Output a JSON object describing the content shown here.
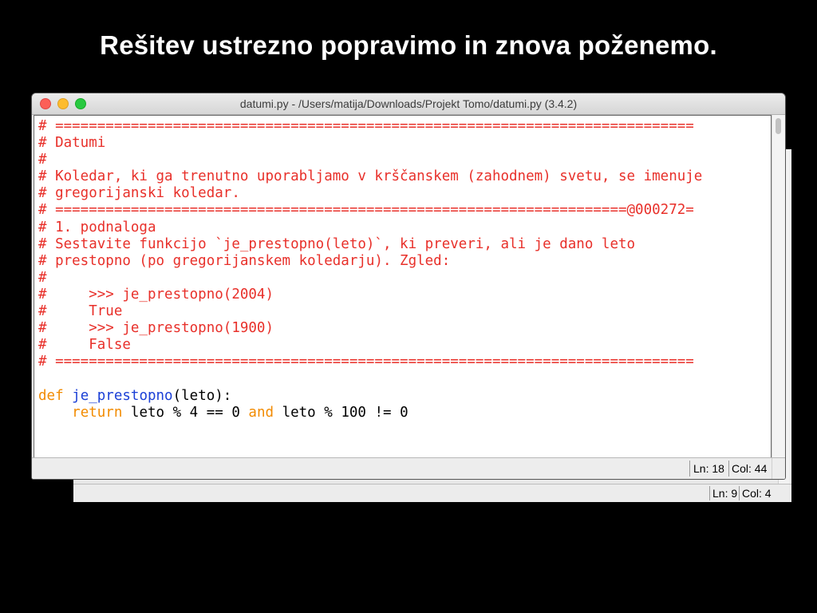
{
  "slide": {
    "title": "Rešitev ustrezno popravimo in znova poženemo."
  },
  "front_window": {
    "title": "datumi.py - /Users/matija/Downloads/Projekt Tomo/datumi.py (3.4.2)",
    "status": {
      "ln": "Ln: 18",
      "col": "Col: 44"
    },
    "colors": {
      "comment": "#e8302a",
      "keyword": "#f28b00",
      "function_name": "#1a3fd6",
      "plain": "#000000"
    },
    "code_lines": [
      [
        {
          "t": "comment",
          "v": "# ============================================================================"
        }
      ],
      [
        {
          "t": "comment",
          "v": "# Datumi"
        }
      ],
      [
        {
          "t": "comment",
          "v": "#"
        }
      ],
      [
        {
          "t": "comment",
          "v": "# Koledar, ki ga trenutno uporabljamo v krščanskem (zahodnem) svetu, se imenuje"
        }
      ],
      [
        {
          "t": "comment",
          "v": "# gregorijanski koledar."
        }
      ],
      [
        {
          "t": "comment",
          "v": "# ====================================================================@000272="
        }
      ],
      [
        {
          "t": "comment",
          "v": "# 1. podnaloga"
        }
      ],
      [
        {
          "t": "comment",
          "v": "# Sestavite funkcijo `je_prestopno(leto)`, ki preveri, ali je dano leto"
        }
      ],
      [
        {
          "t": "comment",
          "v": "# prestopno (po gregorijanskem koledarju). Zgled:"
        }
      ],
      [
        {
          "t": "comment",
          "v": "#"
        }
      ],
      [
        {
          "t": "comment",
          "v": "#     >>> je_prestopno(2004)"
        }
      ],
      [
        {
          "t": "comment",
          "v": "#     True"
        }
      ],
      [
        {
          "t": "comment",
          "v": "#     >>> je_prestopno(1900)"
        }
      ],
      [
        {
          "t": "comment",
          "v": "#     False"
        }
      ],
      [
        {
          "t": "comment",
          "v": "# ============================================================================"
        }
      ],
      [
        {
          "t": "plain",
          "v": ""
        }
      ],
      [
        {
          "t": "keyword",
          "v": "def "
        },
        {
          "t": "def",
          "v": "je_prestopno"
        },
        {
          "t": "plain",
          "v": "(leto):"
        }
      ],
      [
        {
          "t": "plain",
          "v": "    "
        },
        {
          "t": "keyword",
          "v": "return"
        },
        {
          "t": "plain",
          "v": " leto % 4 == 0 "
        },
        {
          "t": "keyword",
          "v": "and"
        },
        {
          "t": "plain",
          "v": " leto % 100 != 0"
        }
      ]
    ]
  },
  "back_window": {
    "status": {
      "ln": "Ln: 9",
      "col": "Col: 4"
    }
  }
}
